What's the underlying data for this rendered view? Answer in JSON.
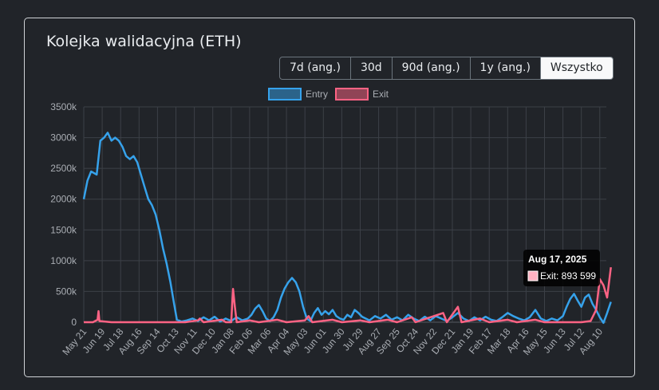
{
  "card": {
    "title": "Kolejka walidacyjna (ETH)"
  },
  "range_buttons": [
    {
      "label": "7d (ang.)"
    },
    {
      "label": "30d"
    },
    {
      "label": "90d (ang.)"
    },
    {
      "label": "1y (ang.)"
    },
    {
      "label": "Wszystko",
      "active": true
    }
  ],
  "colors": {
    "entry": "#36a2eb",
    "exit": "#ff6384",
    "tooltip_bg": "#000000"
  },
  "tooltip": {
    "title": "Aug 17, 2025",
    "label": "Exit: 893 599"
  },
  "chart_data": {
    "type": "line",
    "legend_position": "top",
    "grid": true,
    "ylim": [
      0,
      3500000
    ],
    "y_ticks": [
      "0",
      "500k",
      "1000k",
      "1500k",
      "2000k",
      "2500k",
      "3000k",
      "3500k"
    ],
    "x_ticks": [
      "May 21",
      "Jun 19",
      "Jul 18",
      "Aug 16",
      "Sep 14",
      "Oct 13",
      "Nov 11",
      "Dec 10",
      "Jan 08",
      "Feb 06",
      "Mar 06",
      "Apr 04",
      "May 03",
      "Jun 01",
      "Jun 30",
      "Jul 29",
      "Aug 27",
      "Sep 25",
      "Oct 24",
      "Nov 22",
      "Dec 21",
      "Jan 19",
      "Feb 17",
      "Mar 18",
      "Apr 16",
      "May 15",
      "Jun 13",
      "Jul 12",
      "Aug 10"
    ],
    "series": [
      {
        "name": "Entry",
        "points": [
          [
            0,
            2000000
          ],
          [
            0.2,
            2300000
          ],
          [
            0.4,
            2450000
          ],
          [
            0.7,
            2400000
          ],
          [
            0.9,
            2950000
          ],
          [
            1.1,
            3000000
          ],
          [
            1.3,
            3080000
          ],
          [
            1.5,
            2950000
          ],
          [
            1.7,
            3000000
          ],
          [
            1.9,
            2950000
          ],
          [
            2.1,
            2850000
          ],
          [
            2.3,
            2700000
          ],
          [
            2.5,
            2650000
          ],
          [
            2.7,
            2700000
          ],
          [
            2.9,
            2600000
          ],
          [
            3.1,
            2400000
          ],
          [
            3.3,
            2200000
          ],
          [
            3.5,
            2000000
          ],
          [
            3.7,
            1900000
          ],
          [
            3.9,
            1750000
          ],
          [
            4.1,
            1500000
          ],
          [
            4.3,
            1200000
          ],
          [
            4.5,
            950000
          ],
          [
            4.7,
            650000
          ],
          [
            4.9,
            300000
          ],
          [
            5.05,
            40000
          ],
          [
            5.3,
            10000
          ],
          [
            5.6,
            30000
          ],
          [
            5.9,
            60000
          ],
          [
            6.2,
            20000
          ],
          [
            6.5,
            80000
          ],
          [
            6.8,
            30000
          ],
          [
            7.1,
            90000
          ],
          [
            7.4,
            10000
          ],
          [
            7.7,
            60000
          ],
          [
            8.0,
            20000
          ],
          [
            8.3,
            80000
          ],
          [
            8.6,
            30000
          ],
          [
            8.9,
            60000
          ],
          [
            9.1,
            120000
          ],
          [
            9.3,
            220000
          ],
          [
            9.5,
            280000
          ],
          [
            9.7,
            180000
          ],
          [
            9.9,
            60000
          ],
          [
            10.1,
            20000
          ],
          [
            10.3,
            80000
          ],
          [
            10.5,
            200000
          ],
          [
            10.7,
            400000
          ],
          [
            10.9,
            550000
          ],
          [
            11.1,
            650000
          ],
          [
            11.3,
            720000
          ],
          [
            11.5,
            650000
          ],
          [
            11.7,
            500000
          ],
          [
            11.9,
            250000
          ],
          [
            12.1,
            60000
          ],
          [
            12.3,
            20000
          ],
          [
            12.5,
            150000
          ],
          [
            12.7,
            230000
          ],
          [
            12.9,
            120000
          ],
          [
            13.1,
            180000
          ],
          [
            13.3,
            130000
          ],
          [
            13.5,
            200000
          ],
          [
            13.7,
            100000
          ],
          [
            13.9,
            60000
          ],
          [
            14.1,
            40000
          ],
          [
            14.3,
            120000
          ],
          [
            14.5,
            80000
          ],
          [
            14.7,
            200000
          ],
          [
            14.9,
            150000
          ],
          [
            15.1,
            90000
          ],
          [
            15.3,
            60000
          ],
          [
            15.5,
            30000
          ],
          [
            15.8,
            100000
          ],
          [
            16.1,
            60000
          ],
          [
            16.4,
            120000
          ],
          [
            16.7,
            40000
          ],
          [
            17.0,
            80000
          ],
          [
            17.3,
            30000
          ],
          [
            17.6,
            120000
          ],
          [
            17.9,
            60000
          ],
          [
            18.2,
            20000
          ],
          [
            18.5,
            90000
          ],
          [
            18.8,
            30000
          ],
          [
            19.1,
            100000
          ],
          [
            19.4,
            60000
          ],
          [
            19.7,
            20000
          ],
          [
            20.0,
            80000
          ],
          [
            20.3,
            150000
          ],
          [
            20.6,
            60000
          ],
          [
            20.9,
            20000
          ],
          [
            21.2,
            80000
          ],
          [
            21.5,
            30000
          ],
          [
            21.8,
            90000
          ],
          [
            22.1,
            40000
          ],
          [
            22.4,
            20000
          ],
          [
            22.7,
            80000
          ],
          [
            23.0,
            150000
          ],
          [
            23.3,
            100000
          ],
          [
            23.6,
            60000
          ],
          [
            23.9,
            30000
          ],
          [
            24.2,
            80000
          ],
          [
            24.5,
            200000
          ],
          [
            24.8,
            60000
          ],
          [
            25.1,
            20000
          ],
          [
            25.4,
            60000
          ],
          [
            25.7,
            30000
          ],
          [
            26.0,
            100000
          ],
          [
            26.2,
            250000
          ],
          [
            26.4,
            380000
          ],
          [
            26.6,
            460000
          ],
          [
            26.8,
            350000
          ],
          [
            27.0,
            250000
          ],
          [
            27.2,
            400000
          ],
          [
            27.4,
            450000
          ],
          [
            27.6,
            300000
          ],
          [
            27.8,
            200000
          ],
          [
            28.0,
            80000
          ],
          [
            28.2,
            -10000
          ],
          [
            28.4,
            150000
          ],
          [
            28.6,
            330000
          ]
        ]
      },
      {
        "name": "Exit",
        "points": [
          [
            0,
            0
          ],
          [
            0.5,
            0
          ],
          [
            0.75,
            40000
          ],
          [
            0.8,
            180000
          ],
          [
            0.85,
            20000
          ],
          [
            1.5,
            0
          ],
          [
            2.5,
            0
          ],
          [
            3.5,
            0
          ],
          [
            4.5,
            0
          ],
          [
            5.5,
            0
          ],
          [
            6.2,
            30000
          ],
          [
            6.3,
            60000
          ],
          [
            6.5,
            0
          ],
          [
            7.5,
            40000
          ],
          [
            7.7,
            0
          ],
          [
            8.0,
            0
          ],
          [
            8.1,
            540000
          ],
          [
            8.2,
            250000
          ],
          [
            8.3,
            0
          ],
          [
            9.0,
            30000
          ],
          [
            9.5,
            0
          ],
          [
            10.5,
            40000
          ],
          [
            11.0,
            0
          ],
          [
            12.0,
            30000
          ],
          [
            12.2,
            100000
          ],
          [
            12.4,
            0
          ],
          [
            13.5,
            40000
          ],
          [
            14.0,
            0
          ],
          [
            15.0,
            30000
          ],
          [
            15.5,
            0
          ],
          [
            16.5,
            40000
          ],
          [
            17.0,
            0
          ],
          [
            17.8,
            80000
          ],
          [
            18.0,
            0
          ],
          [
            19.5,
            150000
          ],
          [
            19.7,
            0
          ],
          [
            20.3,
            250000
          ],
          [
            20.5,
            0
          ],
          [
            21.5,
            60000
          ],
          [
            22.0,
            0
          ],
          [
            23.0,
            40000
          ],
          [
            23.5,
            0
          ],
          [
            24.5,
            40000
          ],
          [
            25.0,
            0
          ],
          [
            26.0,
            0
          ],
          [
            27.0,
            0
          ],
          [
            27.5,
            20000
          ],
          [
            27.8,
            200000
          ],
          [
            28.0,
            700000
          ],
          [
            28.2,
            600000
          ],
          [
            28.4,
            400000
          ],
          [
            28.6,
            893599
          ]
        ]
      }
    ]
  }
}
